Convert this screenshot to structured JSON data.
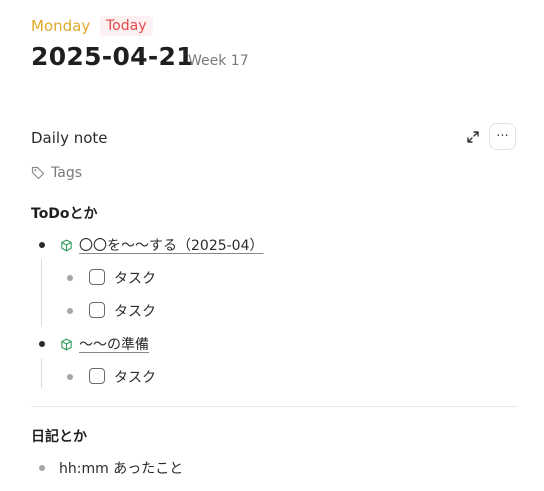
{
  "header": {
    "weekday": "Monday",
    "today_badge": "Today",
    "date": "2025-04-21",
    "week": "Week 17"
  },
  "note": {
    "title": "Daily note",
    "tags_label": "Tags",
    "more_label": "···"
  },
  "todo": {
    "heading": "ToDoとか",
    "projects": [
      {
        "label": "〇〇を〜〜する（2025-04）",
        "icon": "cube-icon",
        "tasks": [
          {
            "label": "タスク",
            "checked": false
          },
          {
            "label": "タスク",
            "checked": false
          }
        ]
      },
      {
        "label": "〜〜の準備",
        "icon": "cube-icon",
        "tasks": [
          {
            "label": "タスク",
            "checked": false
          }
        ]
      }
    ]
  },
  "diary": {
    "heading": "日記とか",
    "entries": [
      "hh:mm あったこと"
    ]
  },
  "colors": {
    "weekday": "#e0a92a",
    "today": "#e5484d",
    "project_icon": "#2f9e5a"
  }
}
